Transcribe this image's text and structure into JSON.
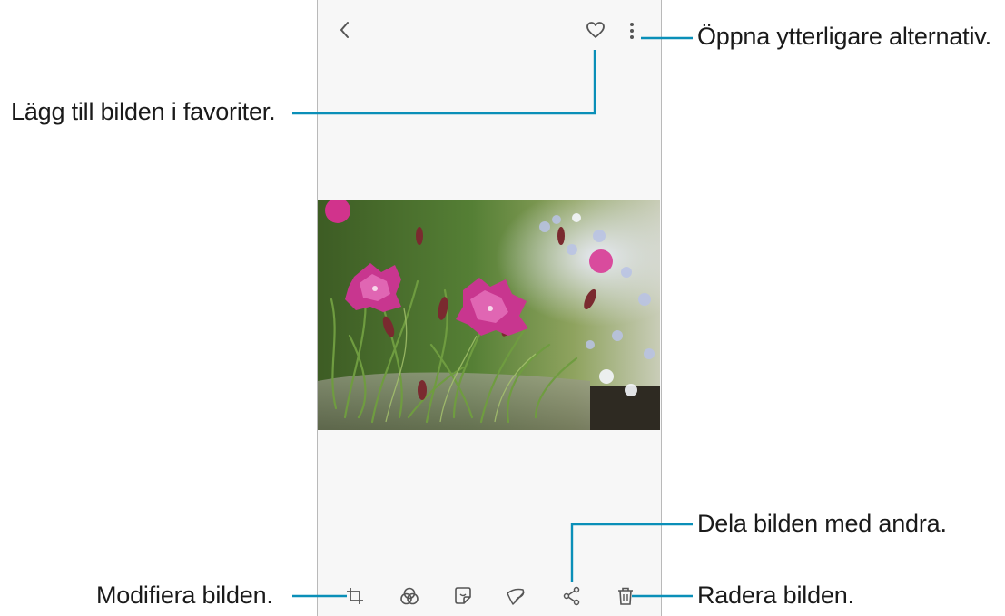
{
  "viewer": {
    "toolbar_top": {
      "back_icon": "chevron-left-icon",
      "favorite_icon": "heart-outline-icon",
      "more_icon": "vertical-dots-icon"
    },
    "photo": {
      "subject": "pink-dianthus-flowers",
      "colors": {
        "petal": "#c8368f",
        "foliage": "#4f7d2e",
        "background": "#f7f7f7"
      }
    },
    "toolbar_bottom": {
      "icons": [
        "crop-rotate-icon",
        "filter-circles-icon",
        "sticker-icon",
        "paint-brush-icon",
        "share-icon",
        "trash-icon"
      ]
    }
  },
  "annotations": {
    "more_options": "Öppna ytterligare alternativ.",
    "add_favorite": "Lägg till bilden i favoriter.",
    "share": "Dela bilden med andra.",
    "edit": "Modifiera bilden.",
    "delete": "Radera bilden."
  },
  "colors": {
    "leader_line": "#0a8fb8",
    "text": "#1a1a1a",
    "icon": "#555555"
  }
}
